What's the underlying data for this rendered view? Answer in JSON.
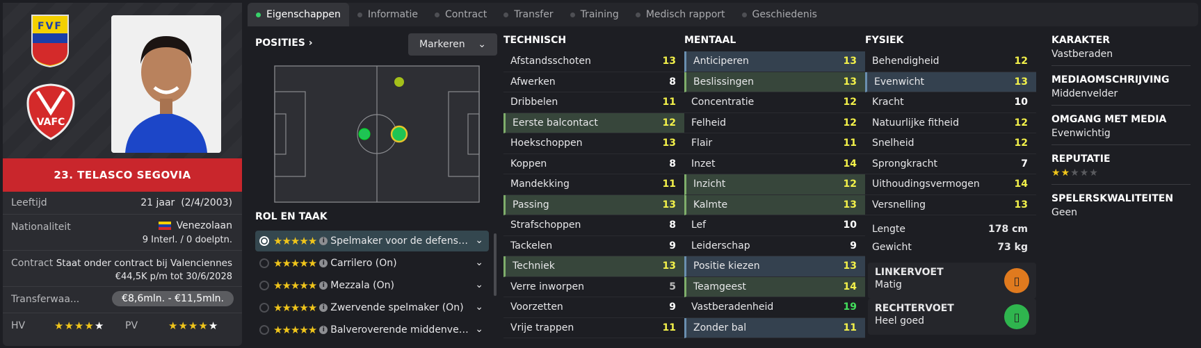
{
  "tabs": [
    {
      "label": "Eigenschappen",
      "active": true
    },
    {
      "label": "Informatie"
    },
    {
      "label": "Contract"
    },
    {
      "label": "Transfer"
    },
    {
      "label": "Training"
    },
    {
      "label": "Medisch rapport"
    },
    {
      "label": "Geschiedenis"
    }
  ],
  "player": {
    "name": "23. TELASCO SEGOVIA",
    "flag_letters": "FVF",
    "club_logo_text": "VAFC",
    "age_label": "Leeftijd",
    "age_value": "21 jaar  (2/4/2003)",
    "nationality_label": "Nationaliteit",
    "nationality_value": "Venezolaan",
    "caps": "9 Interl. / 0 doelptn.",
    "contract_label": "Contract",
    "contract_value": "Staat onder contract bij Valenciennes",
    "contract_detail": "€44,5K p/m tot 30/6/2028",
    "transfer_label": "Transferwaa...",
    "transfer_value": "€8,6mln. - €11,5mln.",
    "hv_label": "HV",
    "hv_stars": 4,
    "pv_label": "PV",
    "pv_stars": 4
  },
  "positions": {
    "title": "POSITIES",
    "mark_label": "Markeren"
  },
  "roles": {
    "title": "ROL EN TAAK",
    "items": [
      {
        "label": "Spelmaker voor de defensi...",
        "stars": 5,
        "selected": true
      },
      {
        "label": "Carrilero (On)",
        "stars": 5
      },
      {
        "label": "Mezzala (On)",
        "stars": 5
      },
      {
        "label": "Zwervende spelmaker (On)",
        "stars": 5
      },
      {
        "label": "Balveroverende middenvel...",
        "stars": 5
      }
    ]
  },
  "technisch": {
    "title": "TECHNISCH",
    "items": [
      {
        "label": "Afstandsschoten",
        "value": "13",
        "color": "y"
      },
      {
        "label": "Afwerken",
        "value": "8",
        "color": "w"
      },
      {
        "label": "Dribbelen",
        "value": "11",
        "color": "y"
      },
      {
        "label": "Eerste balcontact",
        "value": "12",
        "color": "y",
        "hl": "g"
      },
      {
        "label": "Hoekschoppen",
        "value": "13",
        "color": "y"
      },
      {
        "label": "Koppen",
        "value": "8",
        "color": "w"
      },
      {
        "label": "Mandekking",
        "value": "11",
        "color": "y"
      },
      {
        "label": "Passing",
        "value": "13",
        "color": "y",
        "hl": "g"
      },
      {
        "label": "Strafschoppen",
        "value": "8",
        "color": "w"
      },
      {
        "label": "Tackelen",
        "value": "9",
        "color": "w"
      },
      {
        "label": "Techniek",
        "value": "13",
        "color": "y",
        "hl": "g"
      },
      {
        "label": "Verre inworpen",
        "value": "5",
        "color": "gr"
      },
      {
        "label": "Voorzetten",
        "value": "9",
        "color": "w"
      },
      {
        "label": "Vrije trappen",
        "value": "11",
        "color": "y"
      }
    ]
  },
  "mentaal": {
    "title": "MENTAAL",
    "items": [
      {
        "label": "Anticiperen",
        "value": "13",
        "color": "y",
        "hl": "b"
      },
      {
        "label": "Beslissingen",
        "value": "13",
        "color": "y",
        "hl": "g"
      },
      {
        "label": "Concentratie",
        "value": "12",
        "color": "y"
      },
      {
        "label": "Felheid",
        "value": "12",
        "color": "y"
      },
      {
        "label": "Flair",
        "value": "11",
        "color": "y"
      },
      {
        "label": "Inzet",
        "value": "14",
        "color": "y"
      },
      {
        "label": "Inzicht",
        "value": "12",
        "color": "y",
        "hl": "g"
      },
      {
        "label": "Kalmte",
        "value": "13",
        "color": "y",
        "hl": "g"
      },
      {
        "label": "Lef",
        "value": "10",
        "color": "w"
      },
      {
        "label": "Leiderschap",
        "value": "9",
        "color": "w"
      },
      {
        "label": "Positie kiezen",
        "value": "13",
        "color": "y",
        "hl": "b"
      },
      {
        "label": "Teamgeest",
        "value": "14",
        "color": "y",
        "hl": "g"
      },
      {
        "label": "Vastberadenheid",
        "value": "19",
        "color": "g"
      },
      {
        "label": "Zonder bal",
        "value": "11",
        "color": "y",
        "hl": "b"
      }
    ]
  },
  "fysiek": {
    "title": "FYSIEK",
    "items": [
      {
        "label": "Behendigheid",
        "value": "12",
        "color": "y"
      },
      {
        "label": "Evenwicht",
        "value": "13",
        "color": "y",
        "hl": "b"
      },
      {
        "label": "Kracht",
        "value": "10",
        "color": "w"
      },
      {
        "label": "Natuurlijke fitheid",
        "value": "12",
        "color": "y"
      },
      {
        "label": "Snelheid",
        "value": "12",
        "color": "y"
      },
      {
        "label": "Sprongkracht",
        "value": "7",
        "color": "w"
      },
      {
        "label": "Uithoudingsvermogen",
        "value": "14",
        "color": "y"
      },
      {
        "label": "Versnelling",
        "value": "13",
        "color": "y"
      }
    ],
    "height_label": "Lengte",
    "height_value": "178 cm",
    "weight_label": "Gewicht",
    "weight_value": "73 kg",
    "left_foot_title": "LINKERVOET",
    "left_foot_value": "Matig",
    "left_foot_color": "#e07a1e",
    "right_foot_title": "RECHTERVOET",
    "right_foot_value": "Heel goed",
    "right_foot_color": "#2fb54e"
  },
  "right": {
    "karakter_title": "KARAKTER",
    "karakter_value": "Vastberaden",
    "media_desc_title": "MEDIAOMSCHRIJVING",
    "media_desc_value": "Middenvelder",
    "media_handling_title": "OMGANG MET MEDIA",
    "media_handling_value": "Evenwichtig",
    "reputation_title": "REPUTATIE",
    "reputation_stars": 2,
    "qualities_title": "SPELERSKWALITEITEN",
    "qualities_value": "Geen"
  },
  "colors": {
    "accent_red": "#c9262c",
    "value_yellow": "#f3f14a",
    "value_green": "#43e05c",
    "active_tab_dot": "#38d26a"
  }
}
